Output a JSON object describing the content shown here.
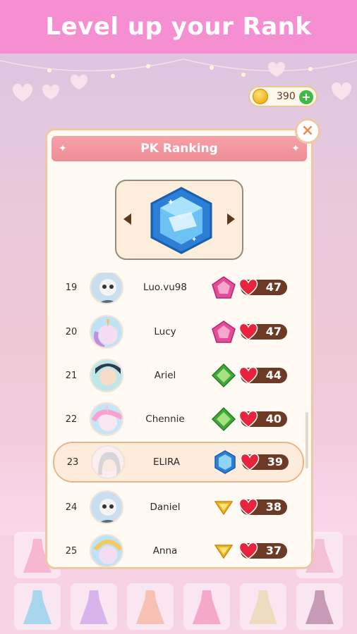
{
  "banner": {
    "title": "Level up your Rank"
  },
  "currency": {
    "coins": "390",
    "add_icon": "plus-icon"
  },
  "panel": {
    "title": "PK Ranking",
    "close_icon": "close-icon",
    "current_tier": "blue-diamond-gem"
  },
  "players": [
    {
      "rank": "19",
      "name": "Luo.vu98",
      "badge": "pink-pentagon-gem",
      "hearts": "47"
    },
    {
      "rank": "20",
      "name": "Lucy",
      "badge": "pink-pentagon-gem",
      "hearts": "47"
    },
    {
      "rank": "21",
      "name": "Ariel",
      "badge": "green-diamond-gem",
      "hearts": "44"
    },
    {
      "rank": "22",
      "name": "Chennie",
      "badge": "green-diamond-gem",
      "hearts": "40"
    },
    {
      "rank": "23",
      "name": "ELIRA",
      "badge": "blue-hexagon-gem",
      "hearts": "39",
      "is_current_user": true
    },
    {
      "rank": "24",
      "name": "Daniel",
      "badge": "gold-triangle-gem",
      "hearts": "38"
    },
    {
      "rank": "25",
      "name": "Anna",
      "badge": "gold-triangle-gem",
      "hearts": "37"
    }
  ],
  "colors": {
    "banner": "#f58fd2",
    "header": "#ee8e95",
    "heart_pill": "#6d3a25",
    "accent_gold": "#f2b21b"
  }
}
